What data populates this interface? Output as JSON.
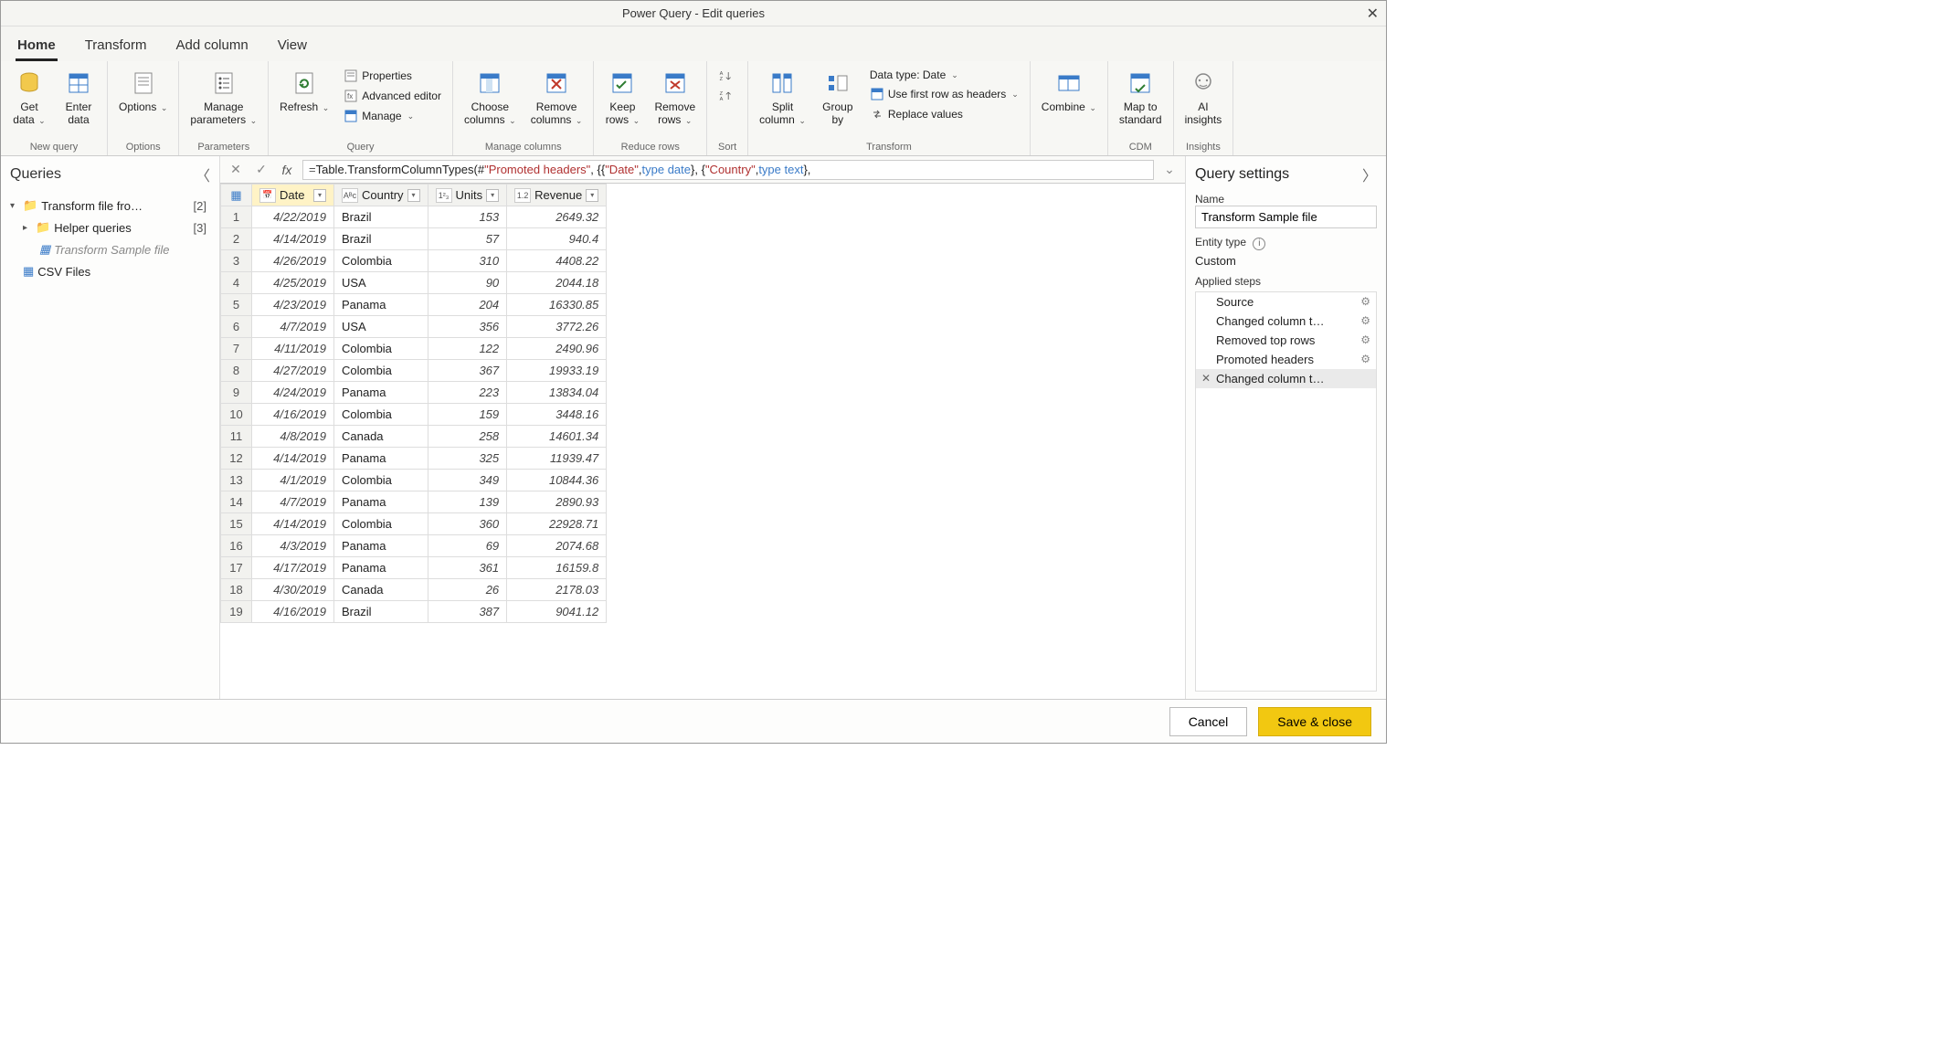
{
  "title": "Power Query - Edit queries",
  "tabs": [
    "Home",
    "Transform",
    "Add column",
    "View"
  ],
  "ribbon": {
    "groups": [
      {
        "label": "New query",
        "items": [
          {
            "label": "Get\ndata",
            "dropdown": true,
            "icon": "cylinder"
          },
          {
            "label": "Enter\ndata",
            "icon": "table"
          }
        ]
      },
      {
        "label": "Options",
        "items": [
          {
            "label": "Options",
            "dropdown": true,
            "icon": "list"
          }
        ]
      },
      {
        "label": "Parameters",
        "items": [
          {
            "label": "Manage\nparameters",
            "dropdown": true,
            "icon": "param"
          }
        ]
      },
      {
        "label": "Query",
        "items": [
          {
            "label": "Refresh",
            "dropdown": true,
            "icon": "refresh"
          },
          {
            "stack": [
              {
                "label": "Properties",
                "icon": "props"
              },
              {
                "label": "Advanced editor",
                "icon": "adv"
              },
              {
                "label": "Manage",
                "dropdown": true,
                "icon": "manage"
              }
            ]
          }
        ]
      },
      {
        "label": "Manage columns",
        "items": [
          {
            "label": "Choose\ncolumns",
            "dropdown": true,
            "icon": "choosecol"
          },
          {
            "label": "Remove\ncolumns",
            "dropdown": true,
            "icon": "removecol"
          }
        ]
      },
      {
        "label": "Reduce rows",
        "items": [
          {
            "label": "Keep\nrows",
            "dropdown": true,
            "icon": "keeprows"
          },
          {
            "label": "Remove\nrows",
            "dropdown": true,
            "icon": "removerows"
          }
        ]
      },
      {
        "label": "Sort",
        "items": [
          {
            "stack": [
              {
                "label": "",
                "icon": "sortasc"
              },
              {
                "label": "",
                "icon": "sortdesc"
              }
            ]
          }
        ]
      },
      {
        "label": "Transform",
        "items": [
          {
            "label": "Split\ncolumn",
            "dropdown": true,
            "icon": "split"
          },
          {
            "label": "Group\nby",
            "icon": "groupby"
          },
          {
            "stack": [
              {
                "label": "Data type: Date",
                "dropdown": true
              },
              {
                "label": "Use first row as headers",
                "dropdown": true,
                "icon": "headers"
              },
              {
                "label": "Replace values",
                "icon": "replace"
              }
            ]
          }
        ]
      },
      {
        "label": "",
        "items": [
          {
            "label": "Combine",
            "dropdown": true,
            "icon": "combine"
          }
        ]
      },
      {
        "label": "CDM",
        "items": [
          {
            "label": "Map to\nstandard",
            "icon": "mapstd"
          }
        ]
      },
      {
        "label": "Insights",
        "items": [
          {
            "label": "AI\ninsights",
            "icon": "ai"
          }
        ]
      }
    ]
  },
  "queries": {
    "title": "Queries",
    "items": [
      {
        "label": "Transform file fro…",
        "count": "[2]",
        "type": "folder",
        "expand": "down"
      },
      {
        "label": "Helper queries",
        "count": "[3]",
        "type": "folder",
        "indent": 1,
        "expand": "right"
      },
      {
        "label": "Transform Sample file",
        "type": "query",
        "indent": 2,
        "selected": true
      },
      {
        "label": "CSV Files",
        "type": "query",
        "indent": 1
      }
    ]
  },
  "formula": {
    "prefix": "=",
    "parts": [
      {
        "t": "  Table.TransformColumnTypes(#"
      },
      {
        "t": "\"Promoted headers\"",
        "c": "str"
      },
      {
        "t": ", {{"
      },
      {
        "t": "\"Date\"",
        "c": "str"
      },
      {
        "t": ", "
      },
      {
        "t": "type date",
        "c": "kw"
      },
      {
        "t": "}, {"
      },
      {
        "t": "\"Country\"",
        "c": "str"
      },
      {
        "t": ", "
      },
      {
        "t": "type text",
        "c": "kw"
      },
      {
        "t": "},"
      }
    ]
  },
  "columns": [
    {
      "name": "Date",
      "type": "date",
      "selected": true
    },
    {
      "name": "Country",
      "type": "text"
    },
    {
      "name": "Units",
      "type": "int"
    },
    {
      "name": "Revenue",
      "type": "dec"
    }
  ],
  "rows": [
    [
      "4/22/2019",
      "Brazil",
      "153",
      "2649.32"
    ],
    [
      "4/14/2019",
      "Brazil",
      "57",
      "940.4"
    ],
    [
      "4/26/2019",
      "Colombia",
      "310",
      "4408.22"
    ],
    [
      "4/25/2019",
      "USA",
      "90",
      "2044.18"
    ],
    [
      "4/23/2019",
      "Panama",
      "204",
      "16330.85"
    ],
    [
      "4/7/2019",
      "USA",
      "356",
      "3772.26"
    ],
    [
      "4/11/2019",
      "Colombia",
      "122",
      "2490.96"
    ],
    [
      "4/27/2019",
      "Colombia",
      "367",
      "19933.19"
    ],
    [
      "4/24/2019",
      "Panama",
      "223",
      "13834.04"
    ],
    [
      "4/16/2019",
      "Colombia",
      "159",
      "3448.16"
    ],
    [
      "4/8/2019",
      "Canada",
      "258",
      "14601.34"
    ],
    [
      "4/14/2019",
      "Panama",
      "325",
      "11939.47"
    ],
    [
      "4/1/2019",
      "Colombia",
      "349",
      "10844.36"
    ],
    [
      "4/7/2019",
      "Panama",
      "139",
      "2890.93"
    ],
    [
      "4/14/2019",
      "Colombia",
      "360",
      "22928.71"
    ],
    [
      "4/3/2019",
      "Panama",
      "69",
      "2074.68"
    ],
    [
      "4/17/2019",
      "Panama",
      "361",
      "16159.8"
    ],
    [
      "4/30/2019",
      "Canada",
      "26",
      "2178.03"
    ],
    [
      "4/16/2019",
      "Brazil",
      "387",
      "9041.12"
    ]
  ],
  "settings": {
    "title": "Query settings",
    "name_label": "Name",
    "name_value": "Transform Sample file",
    "entity_label": "Entity type",
    "entity_value": "Custom",
    "steps_label": "Applied steps",
    "steps": [
      {
        "label": "Source",
        "gear": true
      },
      {
        "label": "Changed column t…",
        "gear": true
      },
      {
        "label": "Removed top rows",
        "gear": true
      },
      {
        "label": "Promoted headers",
        "gear": true
      },
      {
        "label": "Changed column t…",
        "selected": true,
        "x": true
      }
    ]
  },
  "footer": {
    "cancel": "Cancel",
    "save": "Save & close"
  }
}
